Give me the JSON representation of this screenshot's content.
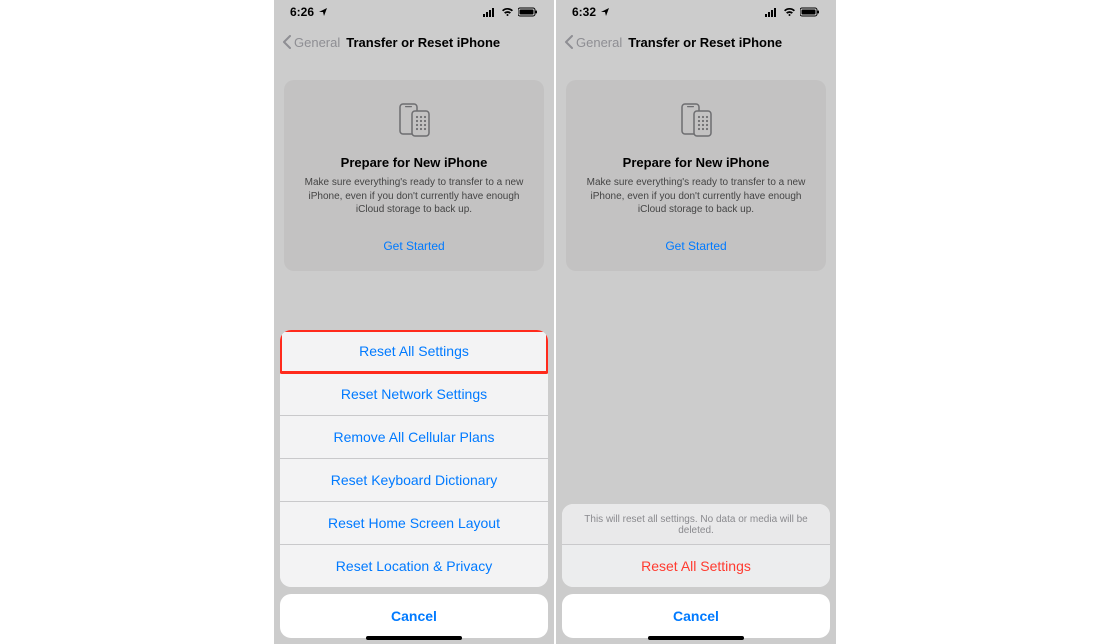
{
  "left": {
    "status": {
      "time": "6:26",
      "indicators": "⋮ ᯤ ▮"
    },
    "nav": {
      "back": "General",
      "title": "Transfer or Reset iPhone"
    },
    "card": {
      "title": "Prepare for New iPhone",
      "desc": "Make sure everything's ready to transfer to a new iPhone, even if you don't currently have enough iCloud storage to back up.",
      "cta": "Get Started"
    },
    "sheet": {
      "items": [
        "Reset All Settings",
        "Reset Network Settings",
        "Remove All Cellular Plans",
        "Reset Keyboard Dictionary",
        "Reset Home Screen Layout",
        "Reset Location & Privacy"
      ],
      "cancel": "Cancel",
      "highlighted_index": 0
    }
  },
  "right": {
    "status": {
      "time": "6:32",
      "indicators": "⋮ ᯤ ▮"
    },
    "nav": {
      "back": "General",
      "title": "Transfer or Reset iPhone"
    },
    "card": {
      "title": "Prepare for New iPhone",
      "desc": "Make sure everything's ready to transfer to a new iPhone, even if you don't currently have enough iCloud storage to back up.",
      "cta": "Get Started"
    },
    "sheet": {
      "desc": "This will reset all settings. No data or media will be deleted.",
      "confirm": "Reset All Settings",
      "cancel": "Cancel"
    }
  }
}
